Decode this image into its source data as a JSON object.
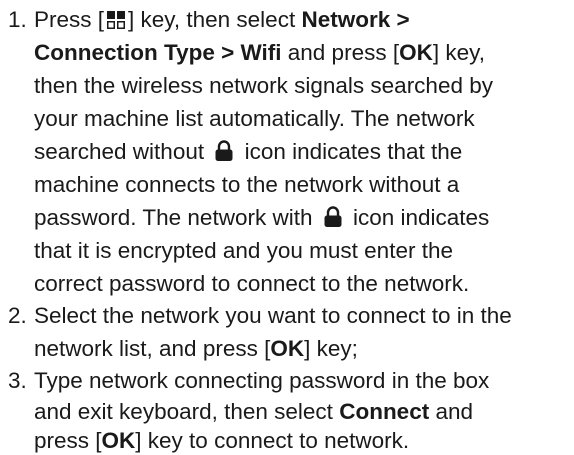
{
  "steps": [
    {
      "number": "1.",
      "lines": {
        "l1a": "Press [",
        "l1b": "] key, then select ",
        "l1c": "Network >",
        "l2a": "Connection Type > Wifi",
        "l2b": " and press [",
        "l2c": "OK",
        "l2d": "] key,",
        "l3": "then the wireless network signals searched by",
        "l4": "your machine list automatically. The network",
        "l5a": "searched without ",
        "l5b": " icon indicates that the",
        "l6": "machine connects to the network without a",
        "l7a": "password. The network with ",
        "l7b": " icon indicates",
        "l8": "that  it is encrypted and you must enter the",
        "l9": "correct  password to connect to the network."
      }
    },
    {
      "number": "2.",
      "lines": {
        "l1": "Select the network you want to connect to in the",
        "l2a": "network list, and press [",
        "l2b": "OK",
        "l2c": "] key;"
      }
    },
    {
      "number": "3.",
      "lines": {
        "l1": "Type network connecting password in the box",
        "l2a": "and exit keyboard, then select ",
        "l2b": "Connect",
        "l2c": " and",
        "l3a": "press [",
        "l3b": "OK",
        "l3c": "] key to connect to network."
      }
    }
  ],
  "icons": {
    "menu_key": "menu-key-icon",
    "lock": "lock-icon"
  }
}
